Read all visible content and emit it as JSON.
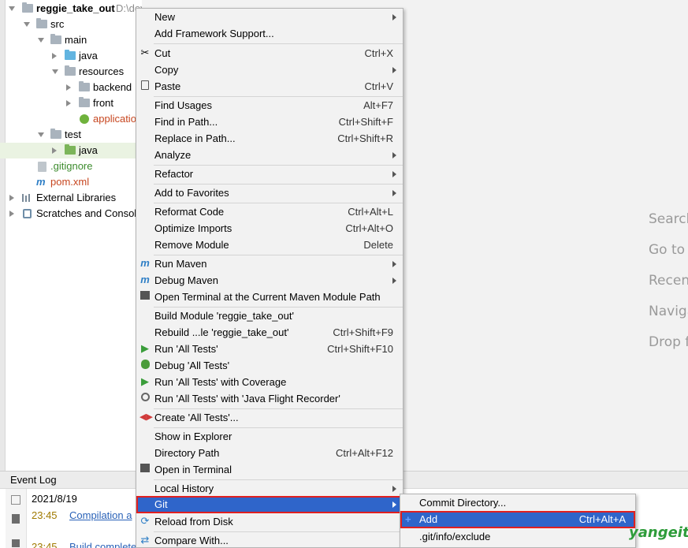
{
  "project": {
    "name": "reggie_take_out",
    "path": "D:\\develop\\idea-workspace\\itheima-reggie-project",
    "tree": {
      "src": "src",
      "main": "main",
      "java": "java",
      "resources": "resources",
      "backend": "backend",
      "front": "front",
      "application": "applicatio",
      "test": "test",
      "test_java": "java",
      "gitignore": ".gitignore",
      "pom": "pom.xml",
      "external": "External Libraries",
      "scratches": "Scratches and Consol"
    }
  },
  "editor_hints": [
    "Search",
    "Go to",
    "Recent",
    "Naviga",
    "Drop f"
  ],
  "event_log": {
    "title": "Event Log",
    "date": "2021/8/19",
    "entries": [
      {
        "time": "23:45",
        "text": "Compilation a"
      },
      {
        "time": "23:45",
        "text": "Build complete"
      }
    ]
  },
  "context_menu": {
    "items": [
      {
        "label": "New",
        "shortcut": "",
        "submenu": true,
        "icon": ""
      },
      {
        "label": "Add Framework Support...",
        "shortcut": "",
        "submenu": false,
        "icon": ""
      },
      {
        "label": "Cut",
        "shortcut": "Ctrl+X",
        "submenu": false,
        "icon": "scissors-icon"
      },
      {
        "label": "Copy",
        "shortcut": "",
        "submenu": true,
        "icon": ""
      },
      {
        "label": "Paste",
        "shortcut": "Ctrl+V",
        "submenu": false,
        "icon": "clipboard-icon"
      },
      {
        "label": "Find Usages",
        "shortcut": "Alt+F7",
        "submenu": false,
        "icon": ""
      },
      {
        "label": "Find in Path...",
        "shortcut": "Ctrl+Shift+F",
        "submenu": false,
        "icon": ""
      },
      {
        "label": "Replace in Path...",
        "shortcut": "Ctrl+Shift+R",
        "submenu": false,
        "icon": ""
      },
      {
        "label": "Analyze",
        "shortcut": "",
        "submenu": true,
        "icon": ""
      },
      {
        "label": "Refactor",
        "shortcut": "",
        "submenu": true,
        "icon": ""
      },
      {
        "label": "Add to Favorites",
        "shortcut": "",
        "submenu": true,
        "icon": ""
      },
      {
        "label": "Reformat Code",
        "shortcut": "Ctrl+Alt+L",
        "submenu": false,
        "icon": ""
      },
      {
        "label": "Optimize Imports",
        "shortcut": "Ctrl+Alt+O",
        "submenu": false,
        "icon": ""
      },
      {
        "label": "Remove Module",
        "shortcut": "Delete",
        "submenu": false,
        "icon": ""
      },
      {
        "label": "Run Maven",
        "shortcut": "",
        "submenu": true,
        "icon": "maven-icon"
      },
      {
        "label": "Debug Maven",
        "shortcut": "",
        "submenu": true,
        "icon": "maven-debug-icon"
      },
      {
        "label": "Open Terminal at the Current Maven Module Path",
        "shortcut": "",
        "submenu": false,
        "icon": "terminal-icon"
      },
      {
        "label": "Build Module 'reggie_take_out'",
        "shortcut": "",
        "submenu": false,
        "icon": ""
      },
      {
        "label": "Rebuild ...le 'reggie_take_out'",
        "shortcut": "Ctrl+Shift+F9",
        "submenu": false,
        "icon": ""
      },
      {
        "label": "Run 'All Tests'",
        "shortcut": "Ctrl+Shift+F10",
        "submenu": false,
        "icon": "run-icon"
      },
      {
        "label": "Debug 'All Tests'",
        "shortcut": "",
        "submenu": false,
        "icon": "bug-icon"
      },
      {
        "label": "Run 'All Tests' with Coverage",
        "shortcut": "",
        "submenu": false,
        "icon": "coverage-icon"
      },
      {
        "label": "Run 'All Tests' with 'Java Flight Recorder'",
        "shortcut": "",
        "submenu": false,
        "icon": "profiler-icon"
      },
      {
        "label": "Create 'All Tests'...",
        "shortcut": "",
        "submenu": false,
        "icon": "create-test-icon"
      },
      {
        "label": "Show in Explorer",
        "shortcut": "",
        "submenu": false,
        "icon": ""
      },
      {
        "label": "Directory Path",
        "shortcut": "Ctrl+Alt+F12",
        "submenu": false,
        "icon": ""
      },
      {
        "label": "Open in Terminal",
        "shortcut": "",
        "submenu": false,
        "icon": "terminal-icon"
      },
      {
        "label": "Local History",
        "shortcut": "",
        "submenu": true,
        "icon": ""
      },
      {
        "label": "Git",
        "shortcut": "",
        "submenu": true,
        "icon": ""
      },
      {
        "label": "Reload from Disk",
        "shortcut": "",
        "submenu": false,
        "icon": "reload-icon"
      },
      {
        "label": "Compare With...",
        "shortcut": "",
        "submenu": false,
        "icon": "compare-icon"
      }
    ]
  },
  "git_submenu": {
    "items": [
      {
        "label": "Commit Directory...",
        "shortcut": ""
      },
      {
        "label": "Add",
        "shortcut": "Ctrl+Alt+A"
      },
      {
        "label": ".git/info/exclude",
        "shortcut": ""
      }
    ]
  },
  "watermark": "yangeit",
  "colors": {
    "highlight": "#2f65ca",
    "highlight_outline": "#e02020"
  }
}
